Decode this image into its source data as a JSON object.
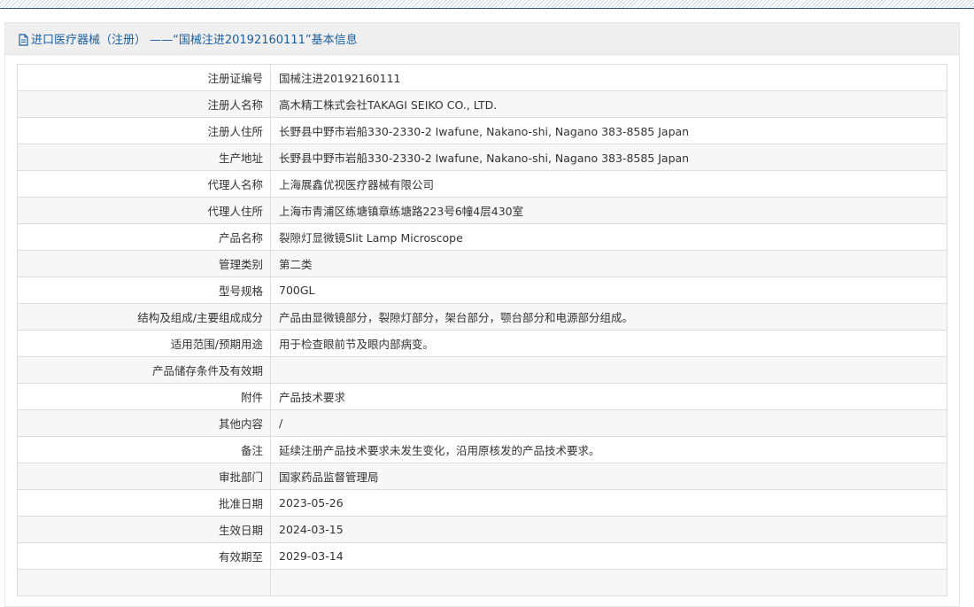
{
  "panel": {
    "title": "进口医疗器械（注册） ——“国械注进20192160111”基本信息",
    "icon": "document-icon"
  },
  "rows": [
    {
      "label": "注册证编号",
      "value": "国械注进20192160111"
    },
    {
      "label": "注册人名称",
      "value": "高木精工株式会社TAKAGI SEIKO CO., LTD."
    },
    {
      "label": "注册人住所",
      "value": "长野县中野市岩船330-2330-2 Iwafune, Nakano-shi, Nagano 383-8585 Japan"
    },
    {
      "label": "生产地址",
      "value": "长野县中野市岩船330-2330-2 Iwafune, Nakano-shi, Nagano 383-8585 Japan"
    },
    {
      "label": "代理人名称",
      "value": "上海展鑫优视医疗器械有限公司"
    },
    {
      "label": "代理人住所",
      "value": "上海市青浦区练塘镇章练塘路223号6幢4层430室"
    },
    {
      "label": "产品名称",
      "value": "裂隙灯显微镜Slit Lamp Microscope"
    },
    {
      "label": "管理类别",
      "value": "第二类"
    },
    {
      "label": "型号规格",
      "value": "700GL"
    },
    {
      "label": "结构及组成/主要组成成分",
      "value": "产品由显微镜部分，裂隙灯部分，架台部分，颚台部分和电源部分组成。"
    },
    {
      "label": "适用范围/预期用途",
      "value": "用于检查眼前节及眼内部病变。"
    },
    {
      "label": "产品储存条件及有效期",
      "value": ""
    },
    {
      "label": "附件",
      "value": "产品技术要求"
    },
    {
      "label": "其他内容",
      "value": "/"
    },
    {
      "label": "备注",
      "value": "延续注册产品技术要求未发生变化，沿用原核发的产品技术要求。"
    },
    {
      "label": "审批部门",
      "value": "国家药品监督管理局"
    },
    {
      "label": "批准日期",
      "value": "2023-05-26"
    },
    {
      "label": "生效日期",
      "value": "2024-03-15"
    },
    {
      "label": "有效期至",
      "value": "2029-03-14"
    },
    {
      "label": "",
      "value": ""
    }
  ],
  "colors": {
    "title": "#1d5fa0",
    "header_bg": "#efefef",
    "row_alt_bg": "#f7f7f7",
    "border": "#dcdcdc",
    "text": "#333333"
  }
}
